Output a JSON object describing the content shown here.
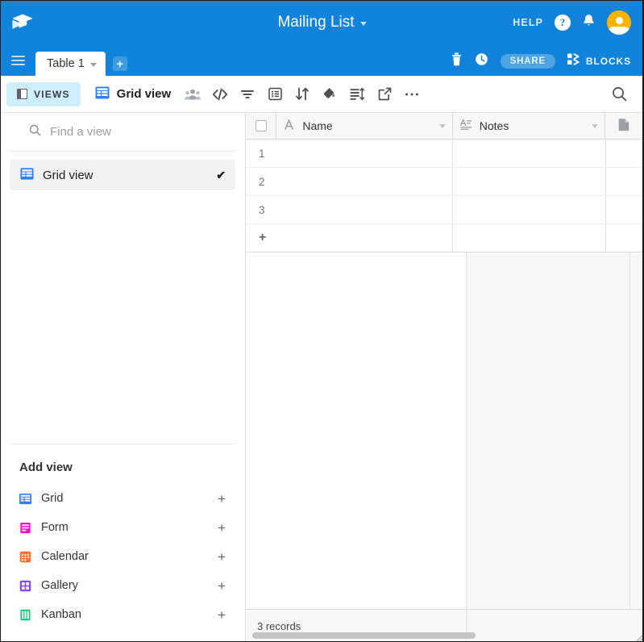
{
  "topbar": {
    "logo_icon": "airtable-logo-icon",
    "app_title": "Mailing List",
    "title_caret_icon": "caret-down-icon",
    "help_label": "HELP",
    "help_icon": "question-circle-icon",
    "notifications_icon": "bell-icon",
    "avatar_icon": "user-avatar-icon",
    "brand_color": "#1283da",
    "avatar_color": "#fcb400"
  },
  "tabbar": {
    "menu_icon": "hamburger-menu-icon",
    "tabs": [
      {
        "label": "Table 1",
        "caret_icon": "caret-down-icon",
        "active": true
      }
    ],
    "add_table_label": "+",
    "trash_icon": "trash-icon",
    "history_icon": "history-clock-icon",
    "share_label": "SHARE",
    "blocks_icon": "blocks-icon",
    "blocks_label": "BLOCKS"
  },
  "toolbar": {
    "views_label": "VIEWS",
    "views_icon": "side-panel-icon",
    "current_view_label": "Grid view",
    "current_view_icon": "grid-view-icon",
    "icons": [
      {
        "name": "collaborators-icon"
      },
      {
        "name": "code-api-icon"
      },
      {
        "name": "filter-icon"
      },
      {
        "name": "group-fields-icon"
      },
      {
        "name": "sort-icon"
      },
      {
        "name": "color-paint-icon"
      },
      {
        "name": "row-height-icon"
      },
      {
        "name": "share-view-icon"
      },
      {
        "name": "more-options-icon"
      }
    ],
    "search_icon": "search-icon",
    "views_button_bg": "#cfeefc"
  },
  "sidebar": {
    "search": {
      "placeholder": "Find a view",
      "value": "",
      "icon": "search-icon"
    },
    "views": [
      {
        "label": "Grid view",
        "icon": "grid-view-icon",
        "icon_color": "#2d7ff9",
        "selected": true,
        "check_glyph": "✔"
      }
    ],
    "add_view_title": "Add view",
    "add_view_options": [
      {
        "label": "Grid",
        "icon": "grid-icon",
        "color": "#2d7ff9",
        "add_glyph": "+"
      },
      {
        "label": "Form",
        "icon": "form-icon",
        "color": "#ff08c2",
        "add_glyph": "+"
      },
      {
        "label": "Calendar",
        "icon": "calendar-icon",
        "color": "#ff6f2c",
        "add_glyph": "+"
      },
      {
        "label": "Gallery",
        "icon": "gallery-icon",
        "color": "#8b46ff",
        "add_glyph": "+"
      },
      {
        "label": "Kanban",
        "icon": "kanban-icon",
        "color": "#02c875",
        "add_glyph": "+"
      }
    ]
  },
  "grid": {
    "select_all_icon": "checkbox-icon",
    "columns": [
      {
        "label": "Name",
        "field_icon": "single-line-text-icon",
        "caret_icon": "caret-down-icon"
      },
      {
        "label": "Notes",
        "field_icon": "long-text-icon",
        "caret_icon": "caret-down-icon"
      },
      {
        "label": "",
        "field_icon": "attachment-icon",
        "caret_icon": ""
      }
    ],
    "rows": [
      {
        "number": "1",
        "Name": "",
        "Notes": ""
      },
      {
        "number": "2",
        "Name": "",
        "Notes": ""
      },
      {
        "number": "3",
        "Name": "",
        "Notes": ""
      }
    ],
    "add_row_glyph": "+",
    "footer_records_label": "3 records"
  }
}
